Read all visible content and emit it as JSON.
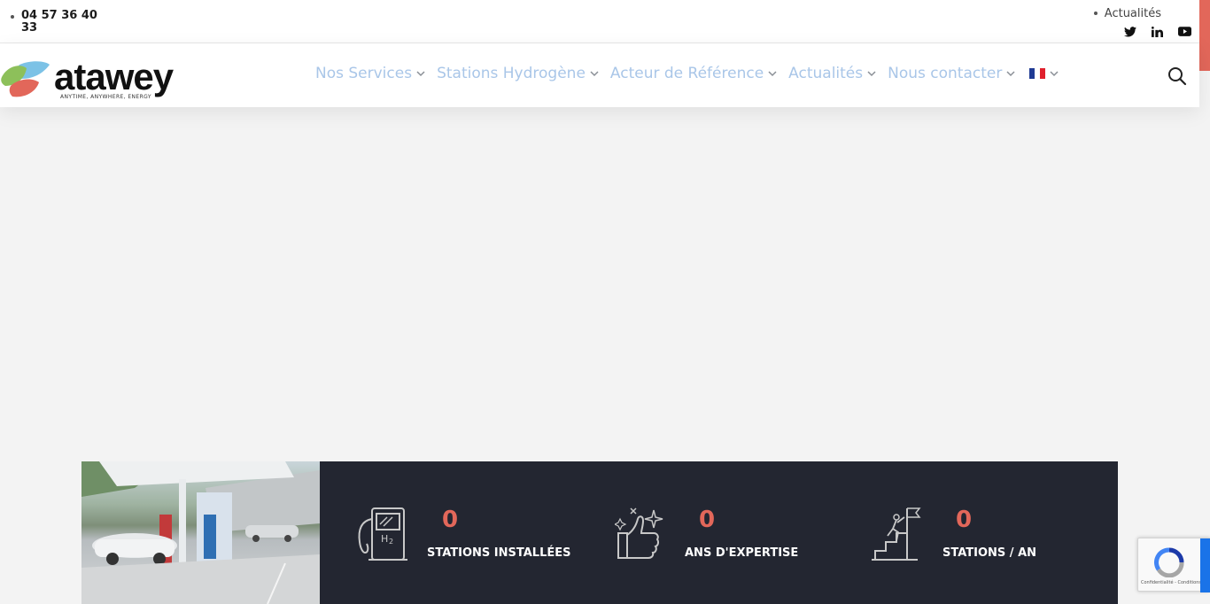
{
  "topbar": {
    "phone": "04 57 36 40 33",
    "link": "Actualités",
    "socials": [
      "twitter-icon",
      "linkedin-icon",
      "youtube-icon"
    ]
  },
  "header": {
    "logo_word": "atawey",
    "logo_tagline": "ANYTIME, ANYWHERE, ENERGY",
    "nav": [
      {
        "label": "Nos Services"
      },
      {
        "label": "Stations Hydrogène"
      },
      {
        "label": "Acteur de Référence"
      },
      {
        "label": "Actualités"
      },
      {
        "label": "Nous contacter"
      }
    ],
    "language": "FR"
  },
  "stats": [
    {
      "icon": "hydrogen-pump-icon",
      "value": "0",
      "label": "STATIONS INSTALLÉES"
    },
    {
      "icon": "thumbs-up-icon",
      "value": "0",
      "label": "ANS D'EXPERTISE"
    },
    {
      "icon": "climber-flag-icon",
      "value": "0",
      "label": "STATIONS / AN"
    }
  ],
  "recaptcha": {
    "footer": "Confidentialité - Conditions"
  },
  "colors": {
    "accent": "#e2675a",
    "nav_text": "#a9c6e8",
    "stats_bg": "#232631",
    "page_bg": "#f3f3f3"
  }
}
